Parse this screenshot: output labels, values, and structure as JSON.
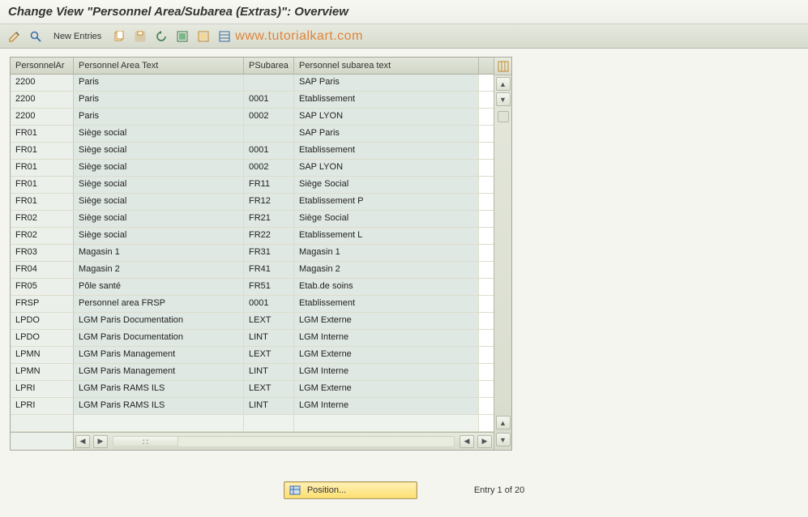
{
  "title": "Change View \"Personnel Area/Subarea (Extras)\": Overview",
  "toolbar": {
    "new_entries_label": "New Entries",
    "watermark": "www.tutorialkart.com"
  },
  "grid": {
    "headers": {
      "personnel_area": "PersonnelAr",
      "personnel_area_text": "Personnel Area Text",
      "psubarea": "PSubarea",
      "personnel_subarea_text": "Personnel subarea text"
    },
    "rows": [
      {
        "pa": "2200",
        "pat": "Paris",
        "ps": "",
        "pst": "SAP Paris"
      },
      {
        "pa": "2200",
        "pat": "Paris",
        "ps": "0001",
        "pst": "Etablissement"
      },
      {
        "pa": "2200",
        "pat": "Paris",
        "ps": "0002",
        "pst": "SAP LYON"
      },
      {
        "pa": "FR01",
        "pat": "Siège social",
        "ps": "",
        "pst": "SAP Paris"
      },
      {
        "pa": "FR01",
        "pat": "Siège social",
        "ps": "0001",
        "pst": "Etablissement"
      },
      {
        "pa": "FR01",
        "pat": "Siège social",
        "ps": "0002",
        "pst": "SAP LYON"
      },
      {
        "pa": "FR01",
        "pat": "Siège social",
        "ps": "FR11",
        "pst": "Siège Social"
      },
      {
        "pa": "FR01",
        "pat": "Siège social",
        "ps": "FR12",
        "pst": "Etablissement P"
      },
      {
        "pa": "FR02",
        "pat": "Siège social",
        "ps": "FR21",
        "pst": "Siège Social"
      },
      {
        "pa": "FR02",
        "pat": "Siège social",
        "ps": "FR22",
        "pst": "Etablissement L"
      },
      {
        "pa": "FR03",
        "pat": "Magasin 1",
        "ps": "FR31",
        "pst": "Magasin 1"
      },
      {
        "pa": "FR04",
        "pat": "Magasin 2",
        "ps": "FR41",
        "pst": "Magasin 2"
      },
      {
        "pa": "FR05",
        "pat": "Pôle santé",
        "ps": "FR51",
        "pst": "Etab.de soins"
      },
      {
        "pa": "FRSP",
        "pat": "Personnel area FRSP",
        "ps": "0001",
        "pst": "Etablissement"
      },
      {
        "pa": "LPDO",
        "pat": "LGM Paris Documentation",
        "ps": "LEXT",
        "pst": "LGM Externe"
      },
      {
        "pa": "LPDO",
        "pat": "LGM Paris Documentation",
        "ps": "LINT",
        "pst": "LGM Interne"
      },
      {
        "pa": "LPMN",
        "pat": "LGM Paris Management",
        "ps": "LEXT",
        "pst": "LGM Externe"
      },
      {
        "pa": "LPMN",
        "pat": "LGM Paris Management",
        "ps": "LINT",
        "pst": "LGM Interne"
      },
      {
        "pa": "LPRI",
        "pat": "LGM Paris RAMS ILS",
        "ps": "LEXT",
        "pst": "LGM Externe"
      },
      {
        "pa": "LPRI",
        "pat": "LGM Paris RAMS ILS",
        "ps": "LINT",
        "pst": "LGM Interne"
      }
    ]
  },
  "footer": {
    "position_label": "Position...",
    "entry_status": "Entry 1 of 20"
  }
}
